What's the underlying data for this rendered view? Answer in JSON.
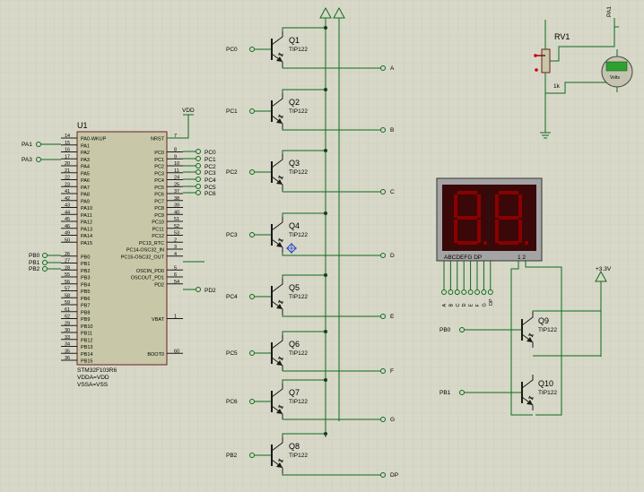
{
  "chip": {
    "ref": "U1",
    "bottom": [
      "STM32F103R6",
      "VDDA=VDD",
      "VSSA=VSS"
    ],
    "left": [
      {
        "n": "14",
        "name": "PA0-WKUP"
      },
      {
        "n": "15",
        "name": "PA1"
      },
      {
        "n": "16",
        "name": "PA2"
      },
      {
        "n": "17",
        "name": "PA3"
      },
      {
        "n": "20",
        "name": "PA4"
      },
      {
        "n": "21",
        "name": "PA5"
      },
      {
        "n": "22",
        "name": "PA6"
      },
      {
        "n": "23",
        "name": "PA7"
      },
      {
        "n": "41",
        "name": "PA8"
      },
      {
        "n": "42",
        "name": "PA9"
      },
      {
        "n": "43",
        "name": "PA10"
      },
      {
        "n": "44",
        "name": "PA11"
      },
      {
        "n": "45",
        "name": "PA12"
      },
      {
        "n": "46",
        "name": "PA13"
      },
      {
        "n": "49",
        "name": "PA14"
      },
      {
        "n": "50",
        "name": "PA15"
      },
      {
        "n": "",
        "name": ""
      },
      {
        "n": "26",
        "name": "PB0"
      },
      {
        "n": "27",
        "name": "PB1"
      },
      {
        "n": "28",
        "name": "PB2"
      },
      {
        "n": "55",
        "name": "PB3"
      },
      {
        "n": "56",
        "name": "PB4"
      },
      {
        "n": "57",
        "name": "PB5"
      },
      {
        "n": "58",
        "name": "PB6"
      },
      {
        "n": "59",
        "name": "PB7"
      },
      {
        "n": "61",
        "name": "PB8"
      },
      {
        "n": "62",
        "name": "PB9"
      },
      {
        "n": "29",
        "name": "PB10"
      },
      {
        "n": "30",
        "name": "PB11"
      },
      {
        "n": "33",
        "name": "PB12"
      },
      {
        "n": "34",
        "name": "PB13"
      },
      {
        "n": "35",
        "name": "PB14"
      },
      {
        "n": "36",
        "name": "PB15"
      }
    ],
    "right": [
      {
        "n": "7",
        "name": "NRST"
      },
      {
        "n": "",
        "name": ""
      },
      {
        "n": "8",
        "name": "PC0"
      },
      {
        "n": "9",
        "name": "PC1"
      },
      {
        "n": "10",
        "name": "PC2"
      },
      {
        "n": "11",
        "name": "PC3"
      },
      {
        "n": "24",
        "name": "PC4"
      },
      {
        "n": "25",
        "name": "PC5"
      },
      {
        "n": "37",
        "name": "PC6"
      },
      {
        "n": "38",
        "name": "PC7"
      },
      {
        "n": "39",
        "name": "PC8"
      },
      {
        "n": "40",
        "name": "PC9"
      },
      {
        "n": "51",
        "name": "PC10"
      },
      {
        "n": "52",
        "name": "PC11"
      },
      {
        "n": "53",
        "name": "PC12"
      },
      {
        "n": "2",
        "name": "PC13_RTC"
      },
      {
        "n": "3",
        "name": "PC14-OSC32_IN"
      },
      {
        "n": "4",
        "name": "PC15-OSC32_OUT"
      },
      {
        "n": "",
        "name": ""
      },
      {
        "n": "5",
        "name": "OSCIN_PD0"
      },
      {
        "n": "6",
        "name": "OSCOUT_PD1"
      },
      {
        "n": "54",
        "name": "PD2"
      },
      {
        "n": "",
        "name": ""
      },
      {
        "n": "",
        "name": ""
      },
      {
        "n": "",
        "name": ""
      },
      {
        "n": "",
        "name": ""
      },
      {
        "n": "1",
        "name": "VBAT"
      },
      {
        "n": "",
        "name": ""
      },
      {
        "n": "",
        "name": ""
      },
      {
        "n": "",
        "name": ""
      },
      {
        "n": "",
        "name": ""
      },
      {
        "n": "60",
        "name": "BOOT0"
      }
    ]
  },
  "vdd": "VDD",
  "chip_left_probes": [
    "PA1",
    "PA3",
    "PB0",
    "PB1",
    "PB2"
  ],
  "chip_right_probes": [
    "PC0",
    "PC1",
    "PC2",
    "PC3",
    "PC4",
    "PC5",
    "PC6",
    "PD2"
  ],
  "transistors": [
    {
      "ref": "Q1",
      "type": "TIP122",
      "base": "PC0",
      "out": "A"
    },
    {
      "ref": "Q2",
      "type": "TIP122",
      "base": "PC1",
      "out": "B"
    },
    {
      "ref": "Q3",
      "type": "TIP122",
      "base": "PC2",
      "out": "C"
    },
    {
      "ref": "Q4",
      "type": "TIP122",
      "base": "PC3",
      "out": "D"
    },
    {
      "ref": "Q5",
      "type": "TIP122",
      "base": "PC4",
      "out": "E"
    },
    {
      "ref": "Q6",
      "type": "TIP122",
      "base": "PC5",
      "out": "F"
    },
    {
      "ref": "Q7",
      "type": "TIP122",
      "base": "PC6",
      "out": "G"
    },
    {
      "ref": "Q8",
      "type": "TIP122",
      "base": "PB2",
      "out": "DP"
    }
  ],
  "digit_transistors": [
    {
      "ref": "Q9",
      "type": "TIP122",
      "base": "PB0"
    },
    {
      "ref": "Q10",
      "type": "TIP122",
      "base": "PB1"
    }
  ],
  "display": {
    "bottom_label": "ABCDEFG  DP",
    "common_label": "1 2",
    "digits": "88",
    "pins": [
      "A",
      "B",
      "C",
      "D",
      "E",
      "F",
      "G",
      "DP"
    ]
  },
  "supply": "+3.3V",
  "pot": {
    "ref": "RV1",
    "value": "1k"
  },
  "voltmeter": {
    "unit": "Volts",
    "probe": "PA1"
  },
  "colors": {
    "bg": "#d8d8c8",
    "chip": "#c8c8a8",
    "display": "#a4a4a4",
    "display_face": "#3a0808",
    "segment": "#8a0000"
  }
}
